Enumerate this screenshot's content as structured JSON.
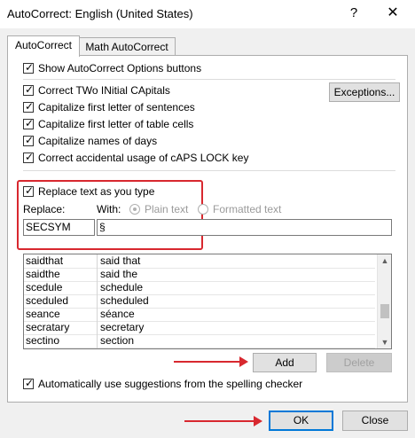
{
  "window": {
    "title": "AutoCorrect: English (United States)",
    "help": "?",
    "close": "✕"
  },
  "tabs": [
    {
      "label": "AutoCorrect"
    },
    {
      "label": "Math AutoCorrect"
    }
  ],
  "options": {
    "show_buttons": "Show AutoCorrect Options buttons",
    "two_initials": "Correct TWo INitial CApitals",
    "first_sentence": "Capitalize first letter of sentences",
    "first_table": "Capitalize first letter of table cells",
    "names_days": "Capitalize names of days",
    "caps_lock": "Correct accidental usage of cAPS LOCK key",
    "exceptions_button": "Exceptions..."
  },
  "replace_section": {
    "replace_as_you_type": "Replace text as you type",
    "replace_label": "Replace:",
    "with_label": "With:",
    "plain_text": "Plain text",
    "formatted_text": "Formatted text",
    "replace_value": "SECSYM",
    "with_value": "§"
  },
  "list": {
    "rows": [
      {
        "from": "saidthat",
        "to": "said that"
      },
      {
        "from": "saidthe",
        "to": "said the"
      },
      {
        "from": "scedule",
        "to": "schedule"
      },
      {
        "from": "sceduled",
        "to": "scheduled"
      },
      {
        "from": "seance",
        "to": "séance"
      },
      {
        "from": "secratary",
        "to": "secretary"
      },
      {
        "from": "sectino",
        "to": "section"
      }
    ],
    "scroll_up": "▲",
    "scroll_down": "▼"
  },
  "buttons": {
    "add": "Add",
    "delete": "Delete",
    "ok": "OK",
    "close": "Close"
  },
  "spelling_option": "Automatically use suggestions from the spelling checker",
  "colors": {
    "highlight": "#d8282f",
    "focus": "#0078d7"
  }
}
